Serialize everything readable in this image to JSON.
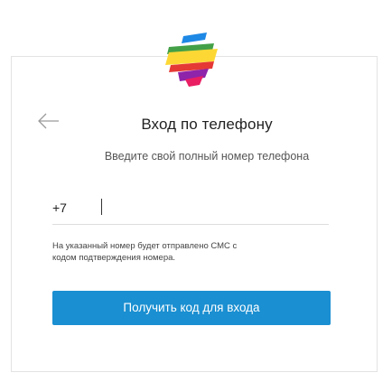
{
  "header": {
    "title": "Вход по телефону",
    "subtitle": "Введите свой полный номер телефона"
  },
  "form": {
    "phone_prefix": "+7",
    "phone_value": "",
    "note_line1": "На указанный номер будет отправлено СМС с",
    "note_line2": "кодом подтверждения номера.",
    "submit_label": "Получить код для входа"
  },
  "icons": {
    "logo": "brand-logo-icon",
    "back": "arrow-left-icon"
  },
  "colors": {
    "accent": "#1a8fd1",
    "logo_blue": "#1e88e5",
    "logo_yellow": "#fdd835",
    "logo_green": "#43a047",
    "logo_red": "#e53935",
    "logo_purple": "#8e24aa"
  }
}
